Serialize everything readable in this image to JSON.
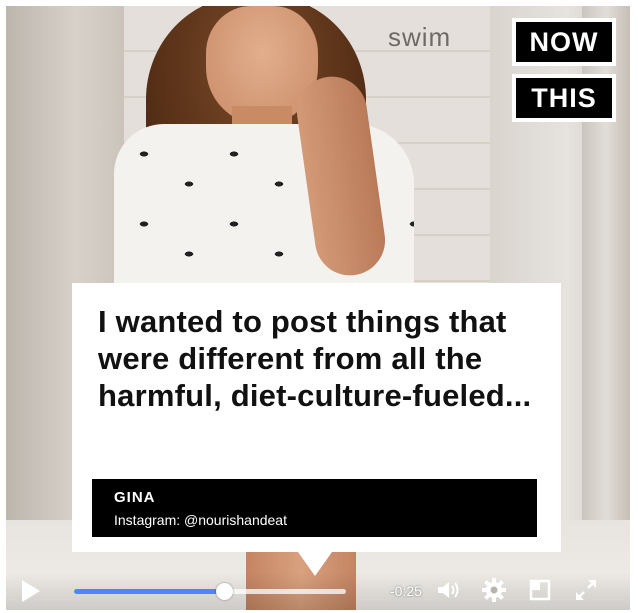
{
  "video": {
    "background_sign": "swim",
    "logo": {
      "line1": "NOW",
      "line2": "THIS"
    },
    "quote": {
      "text": "I wanted to post things that were different from all the harmful, diet-culture-fueled...",
      "name": "GINA",
      "handle": "Instagram: @nourishandeat"
    },
    "controls": {
      "time_remaining": "-0:25",
      "progress_fraction": 0.55,
      "accent_color": "#4b86ff",
      "icons": [
        "play-icon",
        "volume-icon",
        "gear-icon",
        "popout-icon",
        "fullscreen-icon"
      ]
    }
  }
}
